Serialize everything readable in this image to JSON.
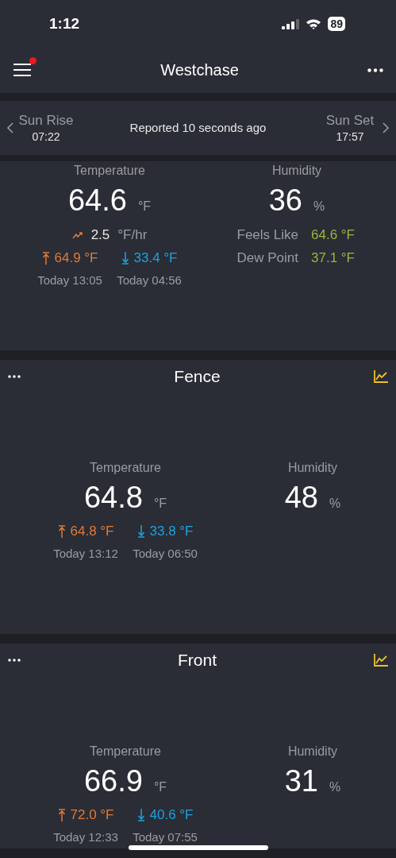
{
  "status_bar": {
    "time": "1:12",
    "battery": "89"
  },
  "header": {
    "title": "Westchase",
    "notification": true
  },
  "sun_bar": {
    "sunrise_label": "Sun Rise",
    "sunrise_time": "07:22",
    "reported": "Reported 10 seconds ago",
    "sunset_label": "Sun Set",
    "sunset_time": "17:57"
  },
  "summary": {
    "temperature": {
      "label": "Temperature",
      "value": "64.6",
      "unit": "°F",
      "trend": "2.5",
      "trend_unit": "°F/hr",
      "high": "64.9 °F",
      "low": "33.4 °F",
      "high_time": "Today 13:05",
      "low_time": "Today 04:56"
    },
    "humidity": {
      "label": "Humidity",
      "value": "36",
      "unit": "%"
    },
    "details": [
      {
        "label": "Feels Like",
        "value": "64.6 °F"
      },
      {
        "label": "Dew Point",
        "value": "37.1 °F"
      }
    ]
  },
  "sensors": [
    {
      "name": "Fence",
      "temperature": {
        "label": "Temperature",
        "value": "64.8",
        "unit": "°F",
        "high": "64.8 °F",
        "low": "33.8 °F",
        "high_time": "Today 13:12",
        "low_time": "Today 06:50"
      },
      "humidity": {
        "label": "Humidity",
        "value": "48",
        "unit": "%"
      }
    },
    {
      "name": "Front",
      "temperature": {
        "label": "Temperature",
        "value": "66.9",
        "unit": "°F",
        "high": "72.0 °F",
        "low": "40.6 °F",
        "high_time": "Today 12:33",
        "low_time": "Today 07:55"
      },
      "humidity": {
        "label": "Humidity",
        "value": "31",
        "unit": "%"
      }
    }
  ]
}
